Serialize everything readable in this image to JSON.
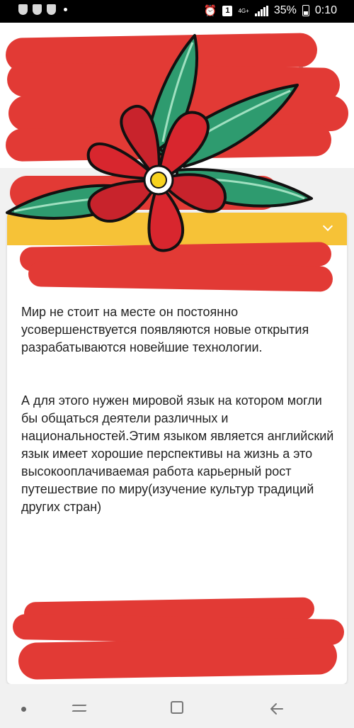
{
  "status_bar": {
    "notification_count": "1",
    "network": "4G+",
    "battery": "35%",
    "time": "0:10"
  },
  "answer": {
    "paragraphs": [
      "Мир не стоит на месте он постоянно усовершенствуется появляются новые открытия разрабатываются новейшие технологии.",
      "А для этого нужен мировой язык на котором могли бы общаться деятели различных и национальностей.Этим языком является английский язык имеет хорошие перспективы на жизнь а это высокооплачиваемая работа карьерный рост путешествие по миру(изучение культур традиций других стран)"
    ]
  },
  "colors": {
    "accent_yellow": "#f6c237",
    "scribble_red": "#e23a35",
    "flower_red": "#d8262e",
    "leaf_green": "#2e9b6f"
  },
  "icons": [
    "shield-icon",
    "notification-dot-icon",
    "signal-icon",
    "battery-icon",
    "back-arrow-icon",
    "chevron-down-icon",
    "nav-recent-icon",
    "nav-home-icon",
    "nav-back-icon"
  ]
}
